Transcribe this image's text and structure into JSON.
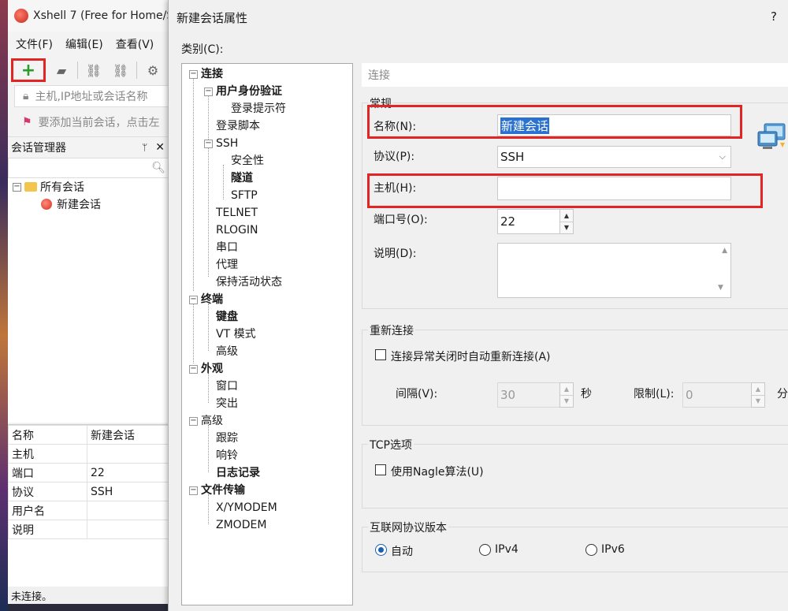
{
  "xshell": {
    "title": "Xshell 7 (Free for Home/S",
    "menu": [
      "文件(F)",
      "编辑(E)",
      "查看(V)"
    ],
    "toolbar": {
      "new_label": "+"
    },
    "address_placeholder": "主机,IP地址或会话名称",
    "hint_text": "要添加当前会话，点击左",
    "session_manager": {
      "title": "会话管理器",
      "pin": "ᛘ",
      "close": "✕"
    },
    "tree": {
      "root": "所有会话",
      "child": "新建会话"
    },
    "properties": [
      {
        "key": "名称",
        "value": "新建会话"
      },
      {
        "key": "主机",
        "value": ""
      },
      {
        "key": "端口",
        "value": "22"
      },
      {
        "key": "协议",
        "value": "SSH"
      },
      {
        "key": "用户名",
        "value": ""
      },
      {
        "key": "说明",
        "value": ""
      }
    ],
    "status": "未连接。"
  },
  "dialog": {
    "title": "新建会话属性",
    "help": "?",
    "category_label": "类别(C):",
    "categories": [
      {
        "label": "连接",
        "bold": true
      },
      {
        "label": "用户身份验证",
        "bold": true
      },
      {
        "label": "登录提示符",
        "bold": false
      },
      {
        "label": "登录脚本",
        "bold": false
      },
      {
        "label": "SSH",
        "bold": false
      },
      {
        "label": "安全性",
        "bold": false
      },
      {
        "label": "隧道",
        "bold": true
      },
      {
        "label": "SFTP",
        "bold": false
      },
      {
        "label": "TELNET",
        "bold": false
      },
      {
        "label": "RLOGIN",
        "bold": false
      },
      {
        "label": "串口",
        "bold": false
      },
      {
        "label": "代理",
        "bold": false
      },
      {
        "label": "保持活动状态",
        "bold": false
      },
      {
        "label": "终端",
        "bold": true
      },
      {
        "label": "键盘",
        "bold": true
      },
      {
        "label": "VT 模式",
        "bold": false
      },
      {
        "label": "高级",
        "bold": false
      },
      {
        "label": "外观",
        "bold": true
      },
      {
        "label": "窗口",
        "bold": false
      },
      {
        "label": "突出",
        "bold": false
      },
      {
        "label": "高级",
        "bold": false
      },
      {
        "label": "跟踪",
        "bold": false
      },
      {
        "label": "响铃",
        "bold": false
      },
      {
        "label": "日志记录",
        "bold": true
      },
      {
        "label": "文件传输",
        "bold": true
      },
      {
        "label": "X/YMODEM",
        "bold": false
      },
      {
        "label": "ZMODEM",
        "bold": false
      }
    ],
    "panel_header": "连接",
    "general": {
      "title": "常规",
      "name_label": "名称(N):",
      "name_value": "新建会话",
      "protocol_label": "协议(P):",
      "protocol_value": "SSH",
      "host_label": "主机(H):",
      "host_value": "",
      "port_label": "端口号(O):",
      "port_value": "22",
      "desc_label": "说明(D):",
      "desc_value": ""
    },
    "reconnect": {
      "title": "重新连接",
      "checkbox_label": "连接异常关闭时自动重新连接(A)",
      "checked": false,
      "interval_label": "间隔(V):",
      "interval_value": "30",
      "interval_unit": "秒",
      "limit_label": "限制(L):",
      "limit_value": "0",
      "limit_unit": "分"
    },
    "tcp": {
      "title": "TCP选项",
      "nagle_label": "使用Nagle算法(U)",
      "checked": false
    },
    "ipver": {
      "title": "互联网协议版本",
      "options": [
        "自动",
        "IPv4",
        "IPv6"
      ],
      "selected": "自动"
    }
  },
  "colors": {
    "highlight_box": "#e12424",
    "selection": "#2a71d0",
    "radio_on": "#1a5fb4"
  }
}
